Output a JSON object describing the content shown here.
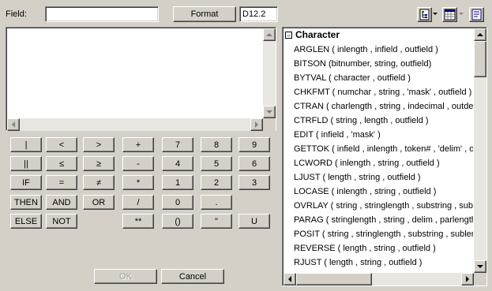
{
  "field": {
    "label": "Field:",
    "value": ""
  },
  "format": {
    "button_label": "Format",
    "value": "D12.2"
  },
  "toolbar": {
    "icons": [
      "tree-view-icon",
      "dropdown-arrow-icon",
      "grid-view-icon",
      "dropdown-arrow-icon",
      "help-book-icon"
    ]
  },
  "keypad": {
    "rows": [
      [
        "|",
        "<",
        ">",
        "+",
        "7",
        "8",
        "9"
      ],
      [
        "||",
        "≤",
        "≥",
        "-",
        "4",
        "5",
        "6"
      ],
      [
        "IF",
        "=",
        "≠",
        "*",
        "1",
        "2",
        "3"
      ],
      [
        "THEN",
        "AND",
        "OR",
        "/",
        "0",
        ".",
        ""
      ],
      [
        "ELSE",
        "NOT",
        "",
        "**",
        "()",
        "\"",
        "U"
      ]
    ]
  },
  "dialog": {
    "ok_label": "OK",
    "cancel_label": "Cancel"
  },
  "functions": {
    "category": "Character",
    "collapse_symbol": "−",
    "items": [
      "ARGLEN ( inlength , infield , outfield )",
      "BITSON (bitnumber, string, outfield)",
      "BYTVAL ( character , outfield )",
      "CHKFMT ( numchar , string , 'mask' , outfield )",
      "CTRAN ( charlength , string , indecimal , outdecimal , outfield )",
      "CTRFLD ( string , length , outfield )",
      "EDIT ( infield , 'mask' )",
      "GETTOK ( infield , inlength , token# , 'delim' , outlength , outfield )",
      "LCWORD ( inlength , string , outfield )",
      "LJUST ( length , string , outfield )",
      "LOCASE ( inlength , string , outfield )",
      "OVRLAY ( string , stringlength , substring , sublength , position , outfield )",
      "PARAG ( stringlength , string , delim , parlength , outfield )",
      "POSIT ( string , stringlength , substring , sublength , outfield )",
      "REVERSE ( length , string , outfield )",
      "RJUST ( length , string , outfield )"
    ]
  }
}
